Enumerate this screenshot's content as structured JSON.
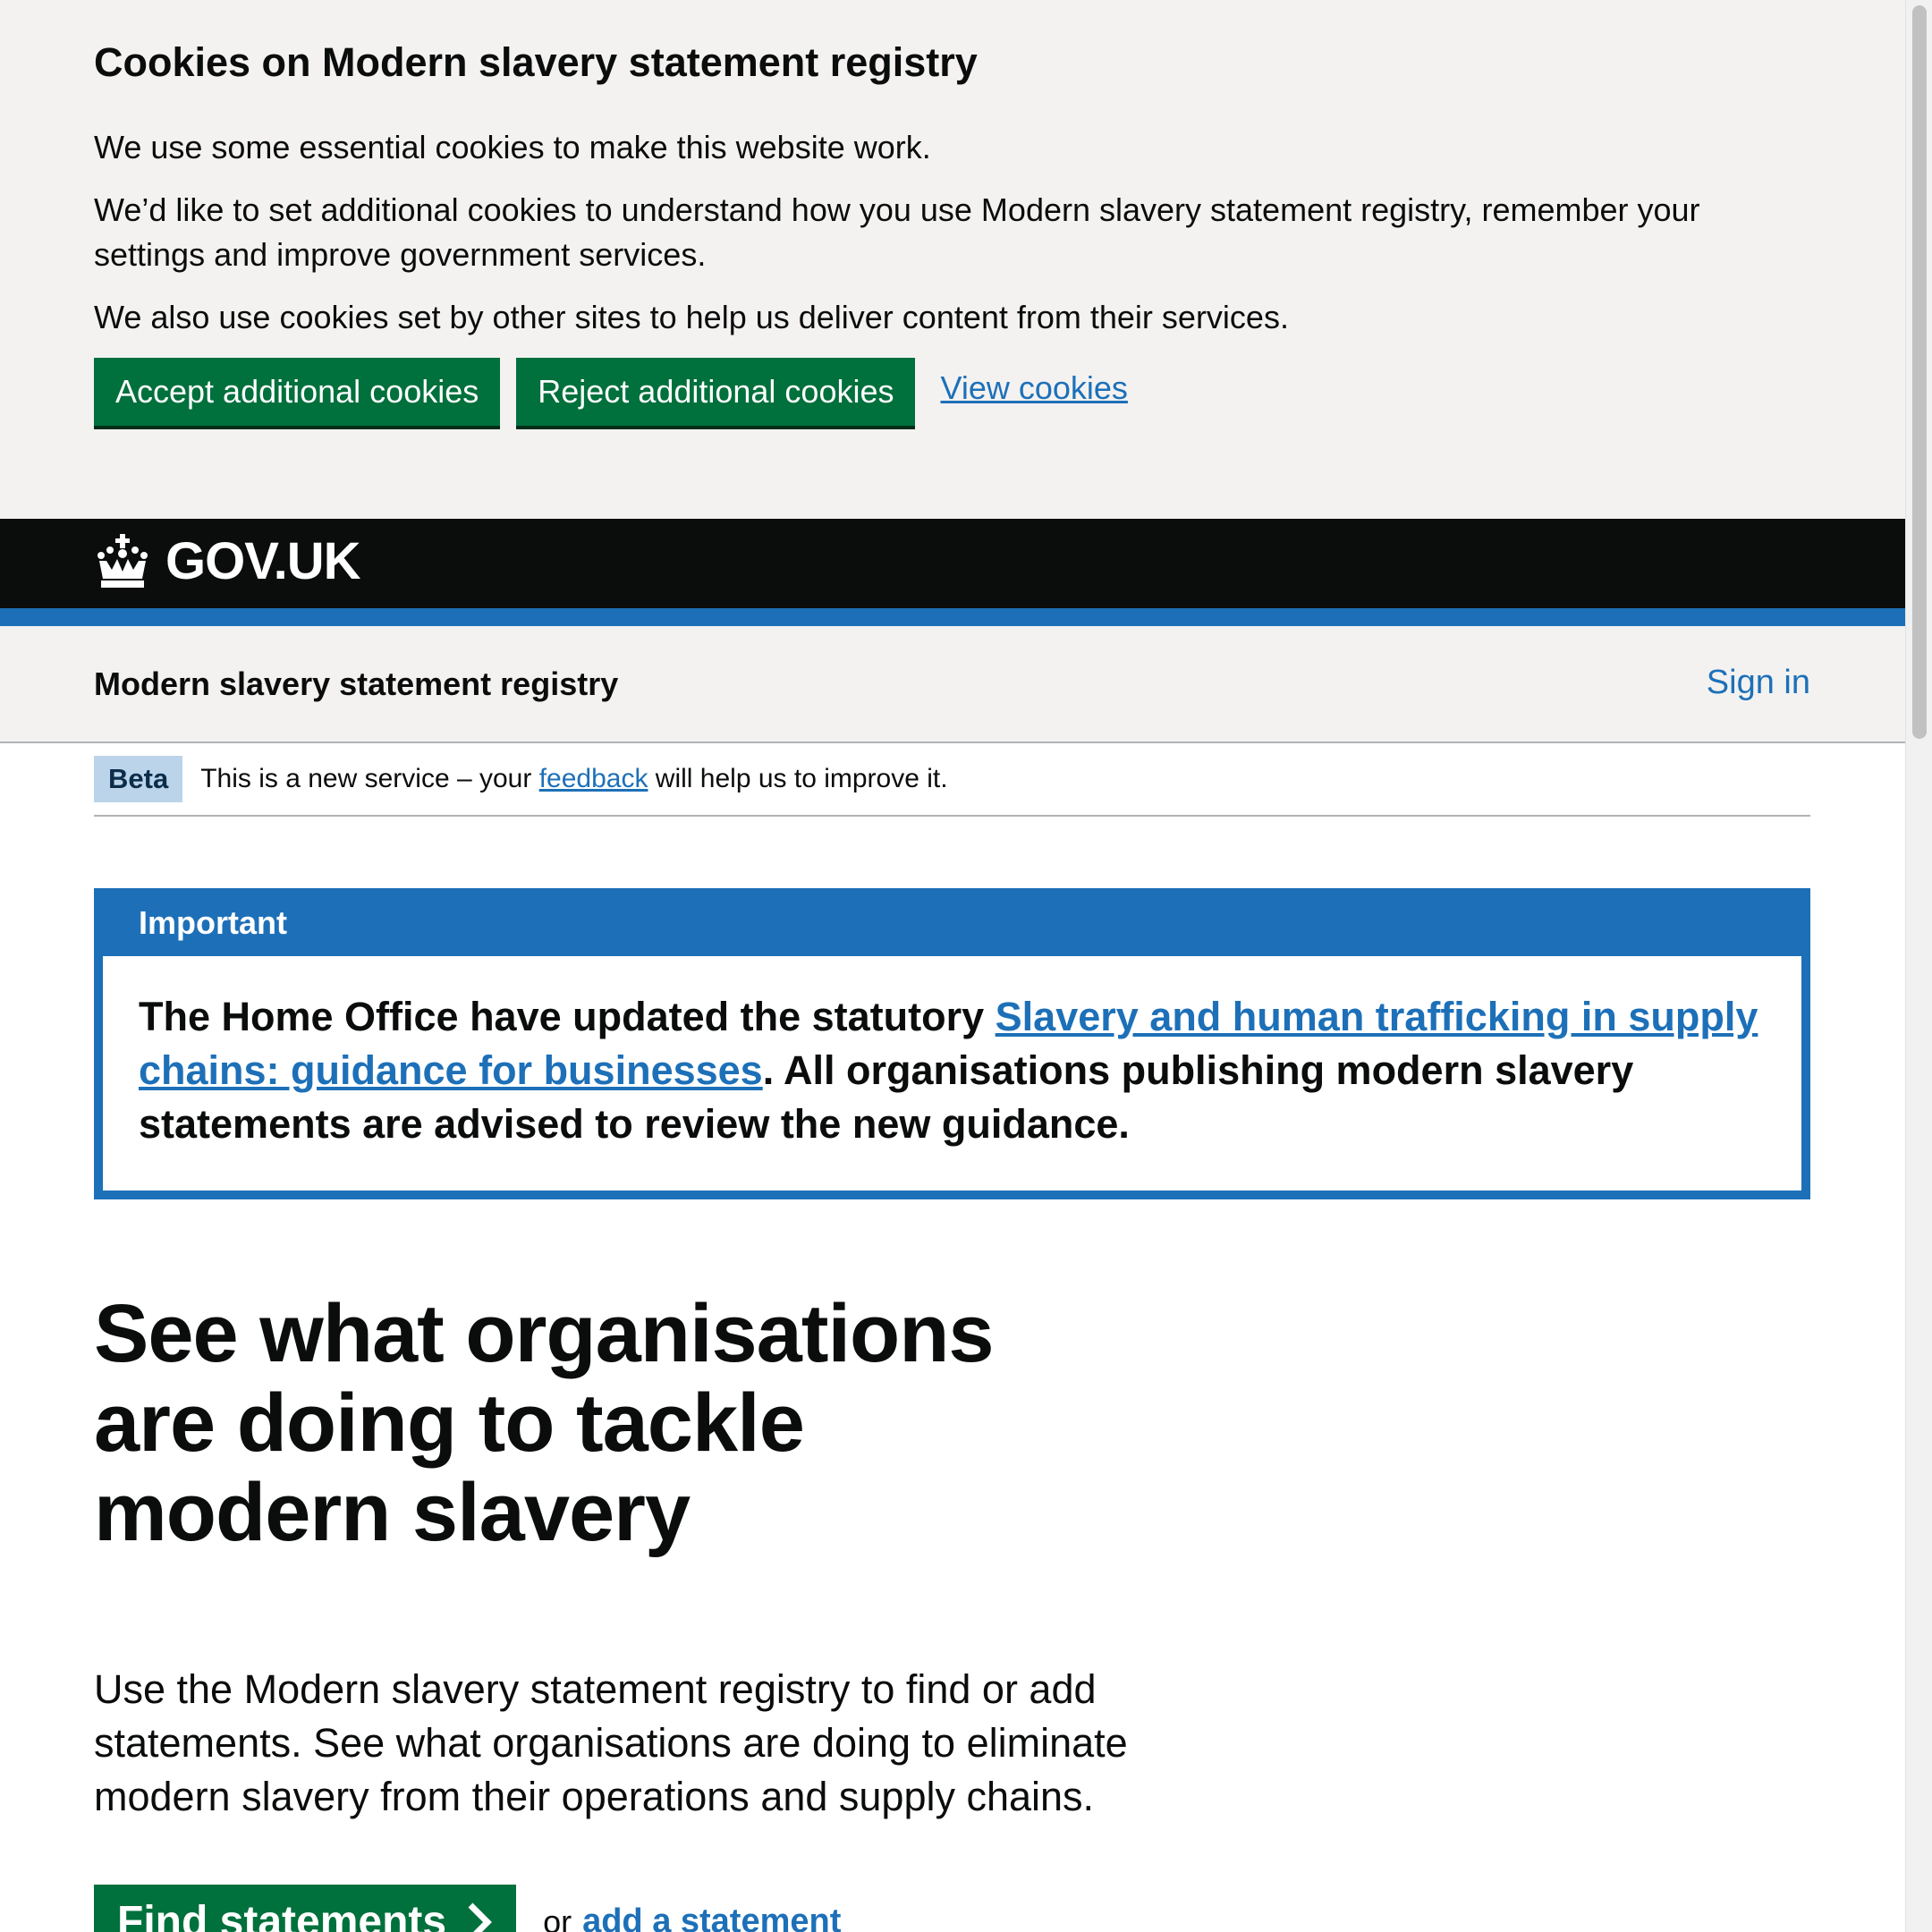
{
  "cookie_banner": {
    "title": "Cookies on Modern slavery statement registry",
    "p1": "We use some essential cookies to make this website work.",
    "p2": "We’d like to set additional cookies to understand how you use Modern slavery statement registry, remember your settings and improve government services.",
    "p3": "We also use cookies set by other sites to help us deliver content from their services.",
    "accept_label": "Accept additional cookies",
    "reject_label": "Reject additional cookies",
    "view_label": "View cookies"
  },
  "header": {
    "logo_text": "GOV.UK",
    "logo_icon": "crown-icon"
  },
  "service": {
    "name": "Modern slavery statement registry",
    "sign_in": "Sign in"
  },
  "phase": {
    "tag": "Beta",
    "text_before": "This is a new service – your ",
    "link": "feedback",
    "text_after": " will help us to improve it."
  },
  "notification": {
    "title": "Important",
    "text_before": "The Home Office have updated the statutory ",
    "link": "Slavery and human trafficking in supply chains: guidance for businesses",
    "text_after": ". All organisations publishing modern slavery statements are advised to review the new guidance."
  },
  "main": {
    "heading": "See what organisations are doing to tackle modern slavery",
    "lead": "Use the Modern slavery statement registry to find or add statements. See what organisations are doing to eliminate modern slavery from their operations and supply chains.",
    "find_label": "Find statements",
    "or_text": "or",
    "add_link": "add a statement"
  },
  "colors": {
    "govuk_blue": "#1d70b8",
    "govuk_green": "#00703c",
    "header_black": "#0b0c0c",
    "light_grey": "#f3f2f1"
  }
}
